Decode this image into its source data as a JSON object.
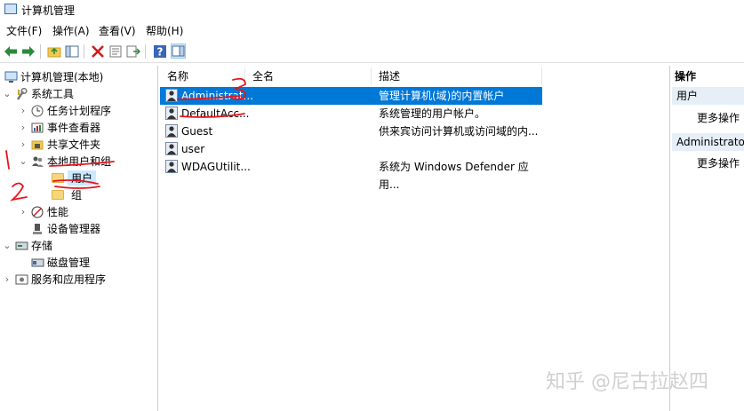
{
  "window": {
    "title": "计算机管理"
  },
  "menu": [
    "文件(F)",
    "操作(A)",
    "查看(V)",
    "帮助(H)"
  ],
  "tree": {
    "root": "计算机管理(本地)",
    "system_tools": "系统工具",
    "task_scheduler": "任务计划程序",
    "event_viewer": "事件查看器",
    "shared_folders": "共享文件夹",
    "local_users_groups": "本地用户和组",
    "users": "用户",
    "groups": "组",
    "performance": "性能",
    "device_manager": "设备管理器",
    "storage": "存储",
    "disk_management": "磁盘管理",
    "services_apps": "服务和应用程序"
  },
  "list": {
    "columns": [
      "名称",
      "全名",
      "描述"
    ],
    "rows": [
      {
        "name": "Administrat...",
        "fullname": "",
        "desc": "管理计算机(域)的内置帐户",
        "selected": true
      },
      {
        "name": "DefaultAcc...",
        "fullname": "",
        "desc": "系统管理的用户帐户。"
      },
      {
        "name": "Guest",
        "fullname": "",
        "desc": "供来宾访问计算机或访问域的内..."
      },
      {
        "name": "user",
        "fullname": "",
        "desc": ""
      },
      {
        "name": "WDAGUtilit...",
        "fullname": "",
        "desc": "系统为 Windows Defender 应用..."
      }
    ]
  },
  "actions": {
    "header": "操作",
    "section1": "用户",
    "more1": "更多操作",
    "section2": "Administrator",
    "more2": "更多操作"
  },
  "watermark": "知乎 @尼古拉赵四",
  "annotations": {
    "mark1": "1",
    "mark2": "2",
    "mark3": "3"
  },
  "colors": {
    "selection": "#0078d7",
    "annotation": "#e8141c"
  }
}
